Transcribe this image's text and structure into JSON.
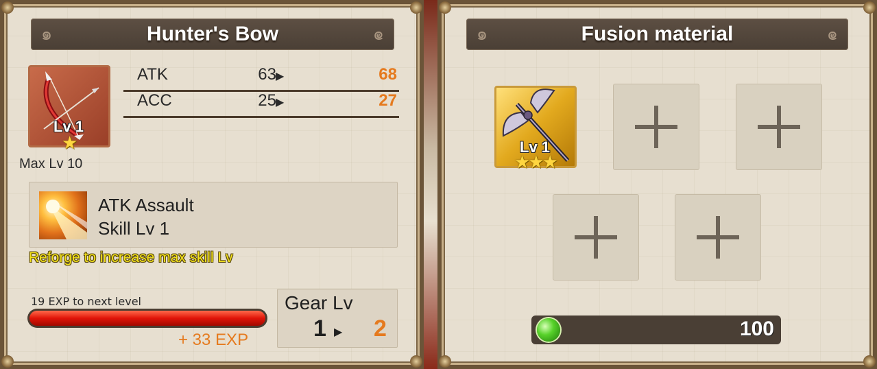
{
  "left_panel": {
    "title": "Hunter's Bow",
    "weapon": {
      "level_label": "Lv 1",
      "stars": 1,
      "max_level": "Max Lv 10"
    },
    "stats": [
      {
        "name": "ATK",
        "current": "63",
        "arrow": "▶",
        "next": "68"
      },
      {
        "name": "ACC",
        "current": "25",
        "arrow": "▶",
        "next": "27"
      }
    ],
    "skill": {
      "name": "ATK Assault",
      "level": "Skill Lv 1"
    },
    "reforge_note": "Reforge to increase max skill Lv",
    "exp": {
      "label": "19 EXP to next level",
      "fill_percent": 100,
      "gain": "+ 33 EXP"
    },
    "gear": {
      "title": "Gear Lv",
      "current": "1",
      "arrow": "▶",
      "next": "2"
    }
  },
  "right_panel": {
    "title": "Fusion material",
    "material": {
      "level_label": "Lv 1",
      "stars": "★★★"
    },
    "empty_slot_count": 4,
    "currency": {
      "icon": "green-gem-icon",
      "value": "100"
    }
  },
  "colors": {
    "accent_orange": "#e57a1e",
    "note_yellow": "#f3e21b",
    "exp_red": "#e01408",
    "title_bar": "#4e4238"
  }
}
